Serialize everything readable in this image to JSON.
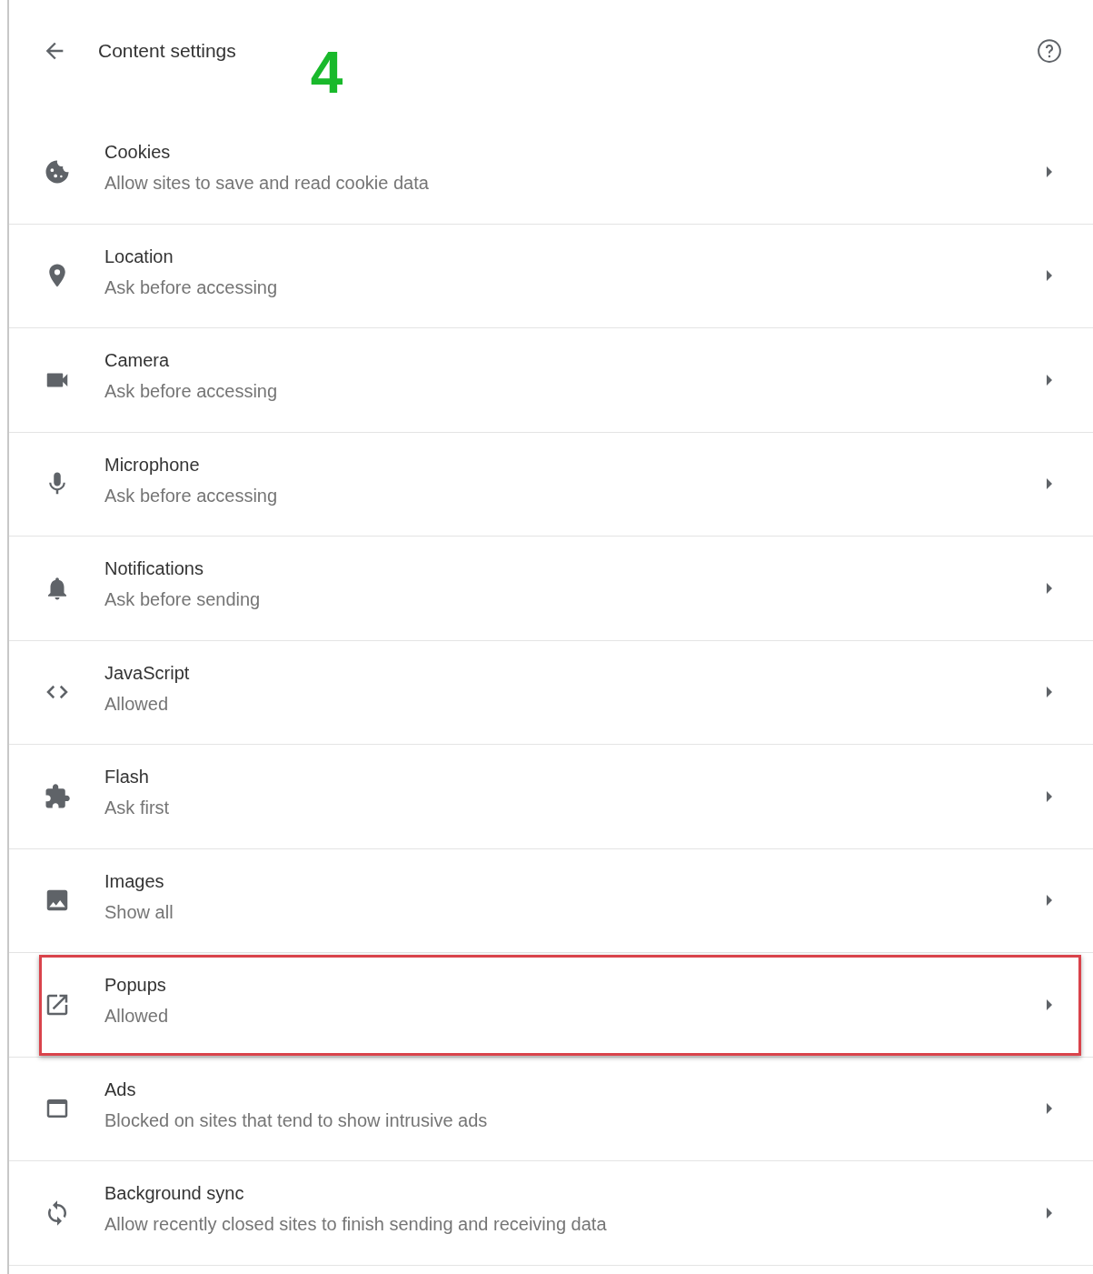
{
  "header": {
    "title": "Content settings",
    "annotation": "4"
  },
  "items": [
    {
      "title": "Cookies",
      "subtitle": "Allow sites to save and read cookie data",
      "highlighted": false
    },
    {
      "title": "Location",
      "subtitle": "Ask before accessing",
      "highlighted": false
    },
    {
      "title": "Camera",
      "subtitle": "Ask before accessing",
      "highlighted": false
    },
    {
      "title": "Microphone",
      "subtitle": "Ask before accessing",
      "highlighted": false
    },
    {
      "title": "Notifications",
      "subtitle": "Ask before sending",
      "highlighted": false
    },
    {
      "title": "JavaScript",
      "subtitle": "Allowed",
      "highlighted": false
    },
    {
      "title": "Flash",
      "subtitle": "Ask first",
      "highlighted": false
    },
    {
      "title": "Images",
      "subtitle": "Show all",
      "highlighted": false
    },
    {
      "title": "Popups",
      "subtitle": "Allowed",
      "highlighted": true
    },
    {
      "title": "Ads",
      "subtitle": "Blocked on sites that tend to show intrusive ads",
      "highlighted": false
    },
    {
      "title": "Background sync",
      "subtitle": "Allow recently closed sites to finish sending and receiving data",
      "highlighted": false
    }
  ]
}
